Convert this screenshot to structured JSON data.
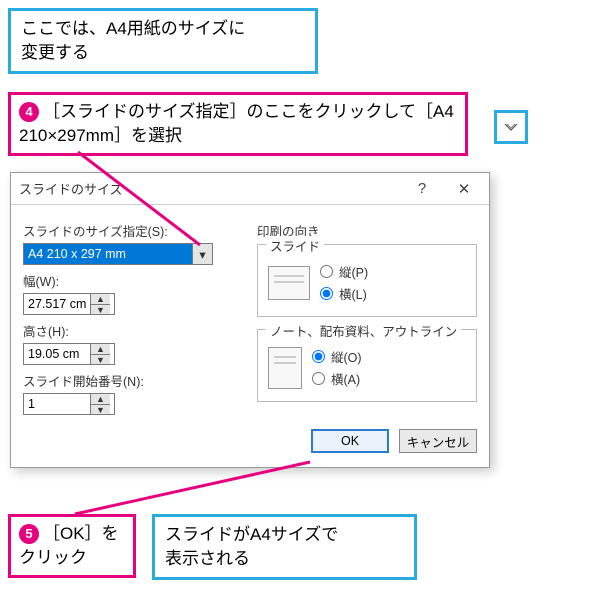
{
  "callouts": {
    "top_blue": "ここでは、A4用紙のサイズに\n変更する",
    "step4_num": "4",
    "step4_text": "［スライドのサイズ指定］のここをクリックして［A4 210×297mm］を選択",
    "step5_num": "5",
    "step5_text": "［OK］をクリック",
    "bottom_blue": "スライドがA4サイズで\n表示される"
  },
  "dialog": {
    "title": "スライドのサイズ",
    "help_btn": "?",
    "close_btn": "✕",
    "left": {
      "size_label": "スライドのサイズ指定(S):",
      "size_value": "A4 210 x 297 mm",
      "width_label": "幅(W):",
      "width_value": "27.517 cm",
      "height_label": "高さ(H):",
      "height_value": "19.05 cm",
      "startnum_label": "スライド開始番号(N):",
      "startnum_value": "1"
    },
    "right": {
      "orientation_title": "印刷の向き",
      "slide_group": "スライド",
      "slide_portrait": "縦(P)",
      "slide_landscape": "横(L)",
      "notes_group": "ノート、配布資料、アウトライン",
      "notes_portrait": "縦(O)",
      "notes_landscape": "横(A)"
    },
    "ok": "OK",
    "cancel": "キャンセル"
  }
}
